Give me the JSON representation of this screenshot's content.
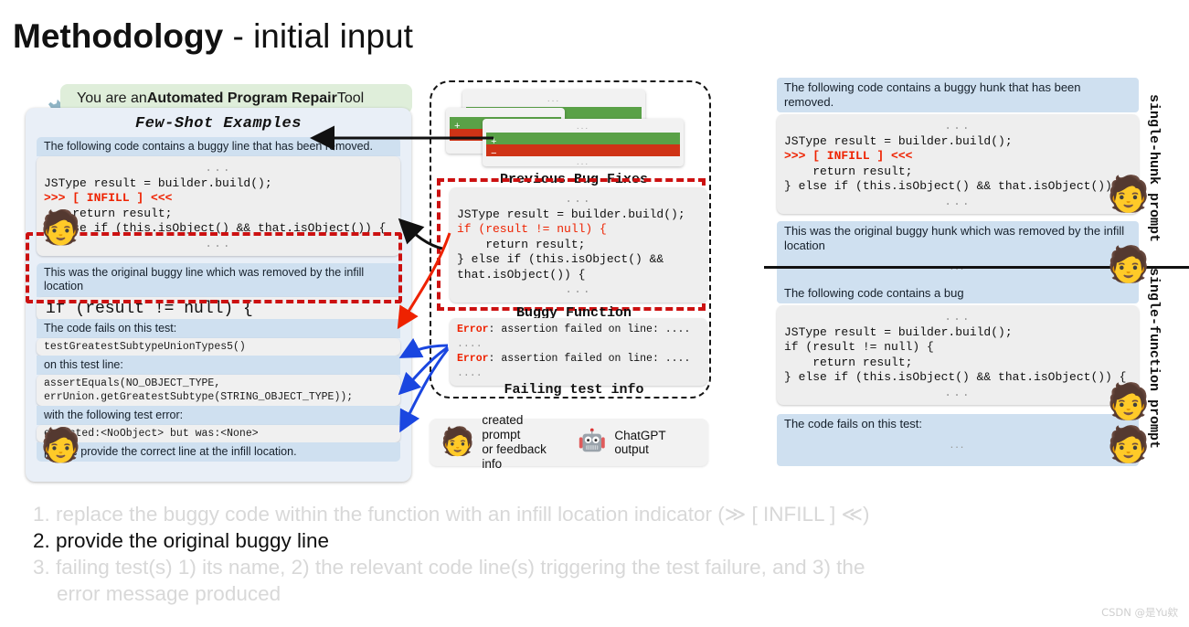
{
  "title": {
    "bold": "Methodology",
    "rest": " - initial input"
  },
  "left_panel": {
    "role_banner": {
      "prefix": "You are an ",
      "bold": "Automated Program Repair",
      "suffix": " Tool"
    },
    "gear_icon": "gear-icon",
    "section_title": "Few-Shot Examples",
    "example": {
      "instruction": "The following code contains a buggy line that has been removed.",
      "code_lines": [
        "...",
        "JSType result = builder.build();",
        ">>> [ INFILL ] <<<",
        "    return result;",
        "} else if (this.isObject() && that.isObject()) {",
        "..."
      ],
      "infill_marker": ">>> [ INFILL ] <<<"
    },
    "buggy": {
      "instruction": "This was the original buggy line which was removed by the infill location",
      "line": "if (result != null) {"
    },
    "test": {
      "fails_label": "The code fails on this test:",
      "test_name": "testGreatestSubtypeUnionTypes5()",
      "on_line_label": "on this test line:",
      "test_line_1": "assertEquals(NO_OBJECT_TYPE,",
      "test_line_2": "errUnion.getGreatestSubtype(STRING_OBJECT_TYPE));",
      "error_label": "with the following test error:",
      "error_text": "expected:<NoObject> but was:<None>",
      "closing": "please provide the correct line at the infill location."
    },
    "user_emoji": "🧑"
  },
  "mid_panel": {
    "caption_bug_fixes": "Previous Bug Fixes",
    "caption_buggy_function": "Buggy Function",
    "caption_failing_tests": "Failing test info",
    "diff_plus_sign": "+",
    "diff_minus_sign": "−",
    "diff_ellipsis": "...",
    "buggy_function_code": [
      "...",
      "JSType result = builder.build();",
      "if (result != null) {",
      "    return result;",
      "} else if (this.isObject() &&",
      "that.isObject()) {",
      "..."
    ],
    "buggy_function_red_line": "if (result != null) {",
    "error_box": {
      "error_label": "Error",
      "line1_rest": ": assertion failed on line: ....",
      "dots": "....",
      "line2_rest": ": assertion failed on line: ...."
    },
    "legend": {
      "person_emoji": "🧑",
      "person_text_1": "created prompt",
      "person_text_2": "or feedback info",
      "robot_icon": "robot-icon",
      "robot_text": "ChatGPT output"
    }
  },
  "right_panel": {
    "hunk": {
      "instruction": "The following code contains a buggy hunk that has been removed.",
      "code_lines": [
        "...",
        "JSType result = builder.build();",
        ">>> [ INFILL ] <<<",
        "    return result;",
        "} else if (this.isObject() && that.isObject()) {",
        "..."
      ],
      "removed_instruction": "This was the original buggy hunk which was removed by the infill location",
      "removed_ellipsis": "..."
    },
    "function": {
      "instruction": "The following code contains a bug",
      "code_lines": [
        "...",
        "JSType result = builder.build();",
        "if (result != null) {",
        "    return result;",
        "} else if (this.isObject() && that.isObject()) {",
        "..."
      ],
      "fails_instruction": "The code fails on this test:",
      "fails_ellipsis": "..."
    },
    "label_hunk": "single-hunk prompt",
    "label_function": "single-function prompt",
    "user_emoji": "🧑"
  },
  "bottom_list": [
    {
      "num": "1.",
      "text": "replace the buggy code within the function with an infill location indicator (≫ [ INFILL ] ≪)",
      "active": false
    },
    {
      "num": "2.",
      "text": "provide the original buggy line",
      "active": true
    },
    {
      "num": "3.",
      "text": "failing test(s) 1) its name, 2) the relevant code line(s) triggering the test failure, and 3) the",
      "text2": "error message produced",
      "active": false
    }
  ],
  "watermark": "CSDN @是Yu欸",
  "colors": {
    "infill_red": "#ee2200",
    "dash_red": "#cc1111",
    "bubble_blue": "#cfe0f0",
    "panel_blue": "#e9eff7",
    "banner_green": "#dfeeda",
    "diff_green": "#5aa147",
    "diff_red": "#cf3316"
  }
}
